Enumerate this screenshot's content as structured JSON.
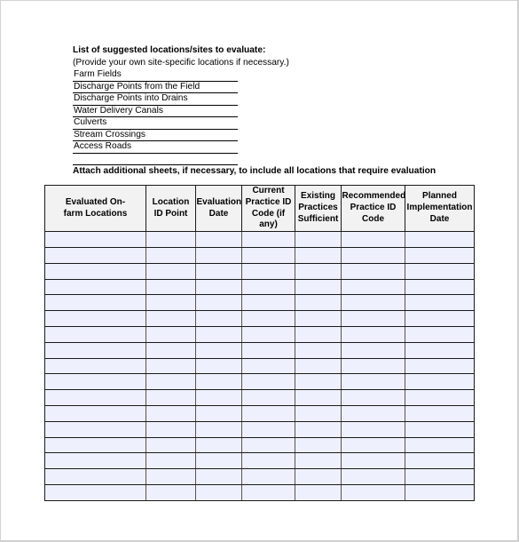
{
  "suggested_locations": {
    "title": "List of suggested locations/sites to evaluate:",
    "subtitle": "(Provide your own site-specific locations if necessary.)",
    "items": [
      "Farm Fields",
      "Discharge Points from the Field",
      "Discharge Points into Drains",
      "Water Delivery Canals",
      "Culverts",
      "Stream Crossings",
      "Access Roads",
      ""
    ]
  },
  "attach_note": "Attach additional sheets, if necessary, to include all locations that require evaluation",
  "table": {
    "columns": [
      "Evaluated On-farm Locations",
      "Location ID Point",
      "Evaluation Date",
      "Current Practice ID Code (if any)",
      "Existing Practices Sufficient",
      "Recommended Practice ID Code",
      "Planned Implementation Date"
    ],
    "row_count": 17,
    "header_bg": "#f2f2f2",
    "row_bg": "#eef1fd"
  }
}
